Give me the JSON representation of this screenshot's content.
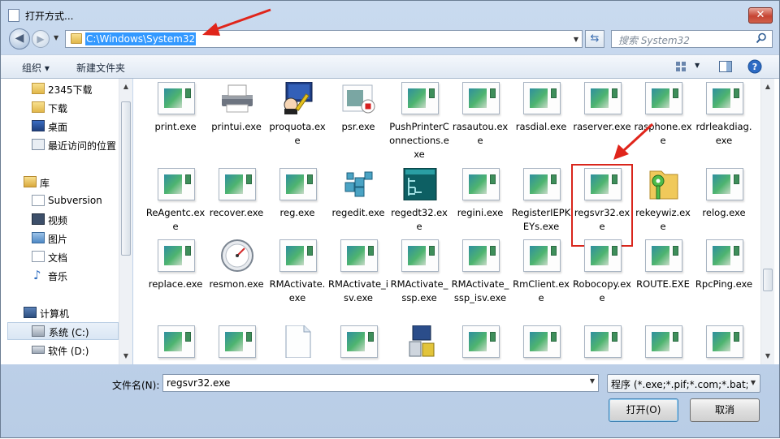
{
  "window": {
    "title": "打开方式..."
  },
  "address": {
    "path": "C:\\Windows\\System32",
    "search_placeholder": "搜索 System32"
  },
  "toolbar": {
    "organize_label": "组织 ▾",
    "new_folder_label": "新建文件夹"
  },
  "nav": {
    "items": [
      {
        "label": "2345下载",
        "icon": "folder-icon"
      },
      {
        "label": "下载",
        "icon": "download-folder-icon"
      },
      {
        "label": "桌面",
        "icon": "desktop-icon"
      },
      {
        "label": "最近访问的位置",
        "icon": "recent-places-icon"
      },
      {
        "label": "库",
        "icon": "library-icon"
      },
      {
        "label": "Subversion",
        "icon": "library-doc-icon"
      },
      {
        "label": "视频",
        "icon": "video-icon"
      },
      {
        "label": "图片",
        "icon": "pictures-icon"
      },
      {
        "label": "文档",
        "icon": "documents-icon"
      },
      {
        "label": "音乐",
        "icon": "music-icon"
      },
      {
        "label": "计算机",
        "icon": "computer-icon"
      },
      {
        "label": "系统 (C:)",
        "icon": "drive-icon"
      },
      {
        "label": "软件 (D:)",
        "icon": "drive-icon"
      }
    ]
  },
  "files": [
    {
      "name": "print.exe",
      "icon": "app-icon"
    },
    {
      "name": "printui.exe",
      "icon": "printer-icon"
    },
    {
      "name": "proquota.exe",
      "icon": "proquota-icon"
    },
    {
      "name": "psr.exe",
      "icon": "psr-icon"
    },
    {
      "name": "PushPrinterConnections.exe",
      "icon": "app-icon"
    },
    {
      "name": "rasautou.exe",
      "icon": "app-icon"
    },
    {
      "name": "rasdial.exe",
      "icon": "app-icon"
    },
    {
      "name": "raserver.exe",
      "icon": "app-icon"
    },
    {
      "name": "rasphone.exe",
      "icon": "app-icon"
    },
    {
      "name": "rdrleakdiag.exe",
      "icon": "app-icon"
    },
    {
      "name": "ReAgentc.exe",
      "icon": "app-icon"
    },
    {
      "name": "recover.exe",
      "icon": "app-icon"
    },
    {
      "name": "reg.exe",
      "icon": "app-icon"
    },
    {
      "name": "regedit.exe",
      "icon": "regedit-icon"
    },
    {
      "name": "regedt32.exe",
      "icon": "regedt32-icon"
    },
    {
      "name": "regini.exe",
      "icon": "app-icon"
    },
    {
      "name": "RegisterIEPKEYs.exe",
      "icon": "app-icon"
    },
    {
      "name": "regsvr32.exe",
      "icon": "app-icon",
      "highlighted": true
    },
    {
      "name": "rekeywiz.exe",
      "icon": "key-folder-icon"
    },
    {
      "name": "relog.exe",
      "icon": "app-icon"
    },
    {
      "name": "replace.exe",
      "icon": "app-icon"
    },
    {
      "name": "resmon.exe",
      "icon": "gauge-icon"
    },
    {
      "name": "RMActivate.exe",
      "icon": "app-icon"
    },
    {
      "name": "RMActivate_isv.exe",
      "icon": "app-icon"
    },
    {
      "name": "RMActivate_ssp.exe",
      "icon": "app-icon"
    },
    {
      "name": "RMActivate_ssp_isv.exe",
      "icon": "app-icon"
    },
    {
      "name": "RmClient.exe",
      "icon": "app-icon"
    },
    {
      "name": "Robocopy.exe",
      "icon": "app-icon"
    },
    {
      "name": "ROUTE.EXE",
      "icon": "app-icon"
    },
    {
      "name": "RpcPing.exe",
      "icon": "app-icon"
    }
  ],
  "bottom": {
    "filename_label": "文件名(N):",
    "filename_value": "regsvr32.exe",
    "filetype_value": "程序 (*.exe;*.pif;*.com;*.bat;*.",
    "open_label": "打开(O)",
    "cancel_label": "取消"
  },
  "colors": {
    "highlight_box": "#d9261c",
    "annotation_arrow": "#e0251b",
    "selection": "#3399ff"
  }
}
